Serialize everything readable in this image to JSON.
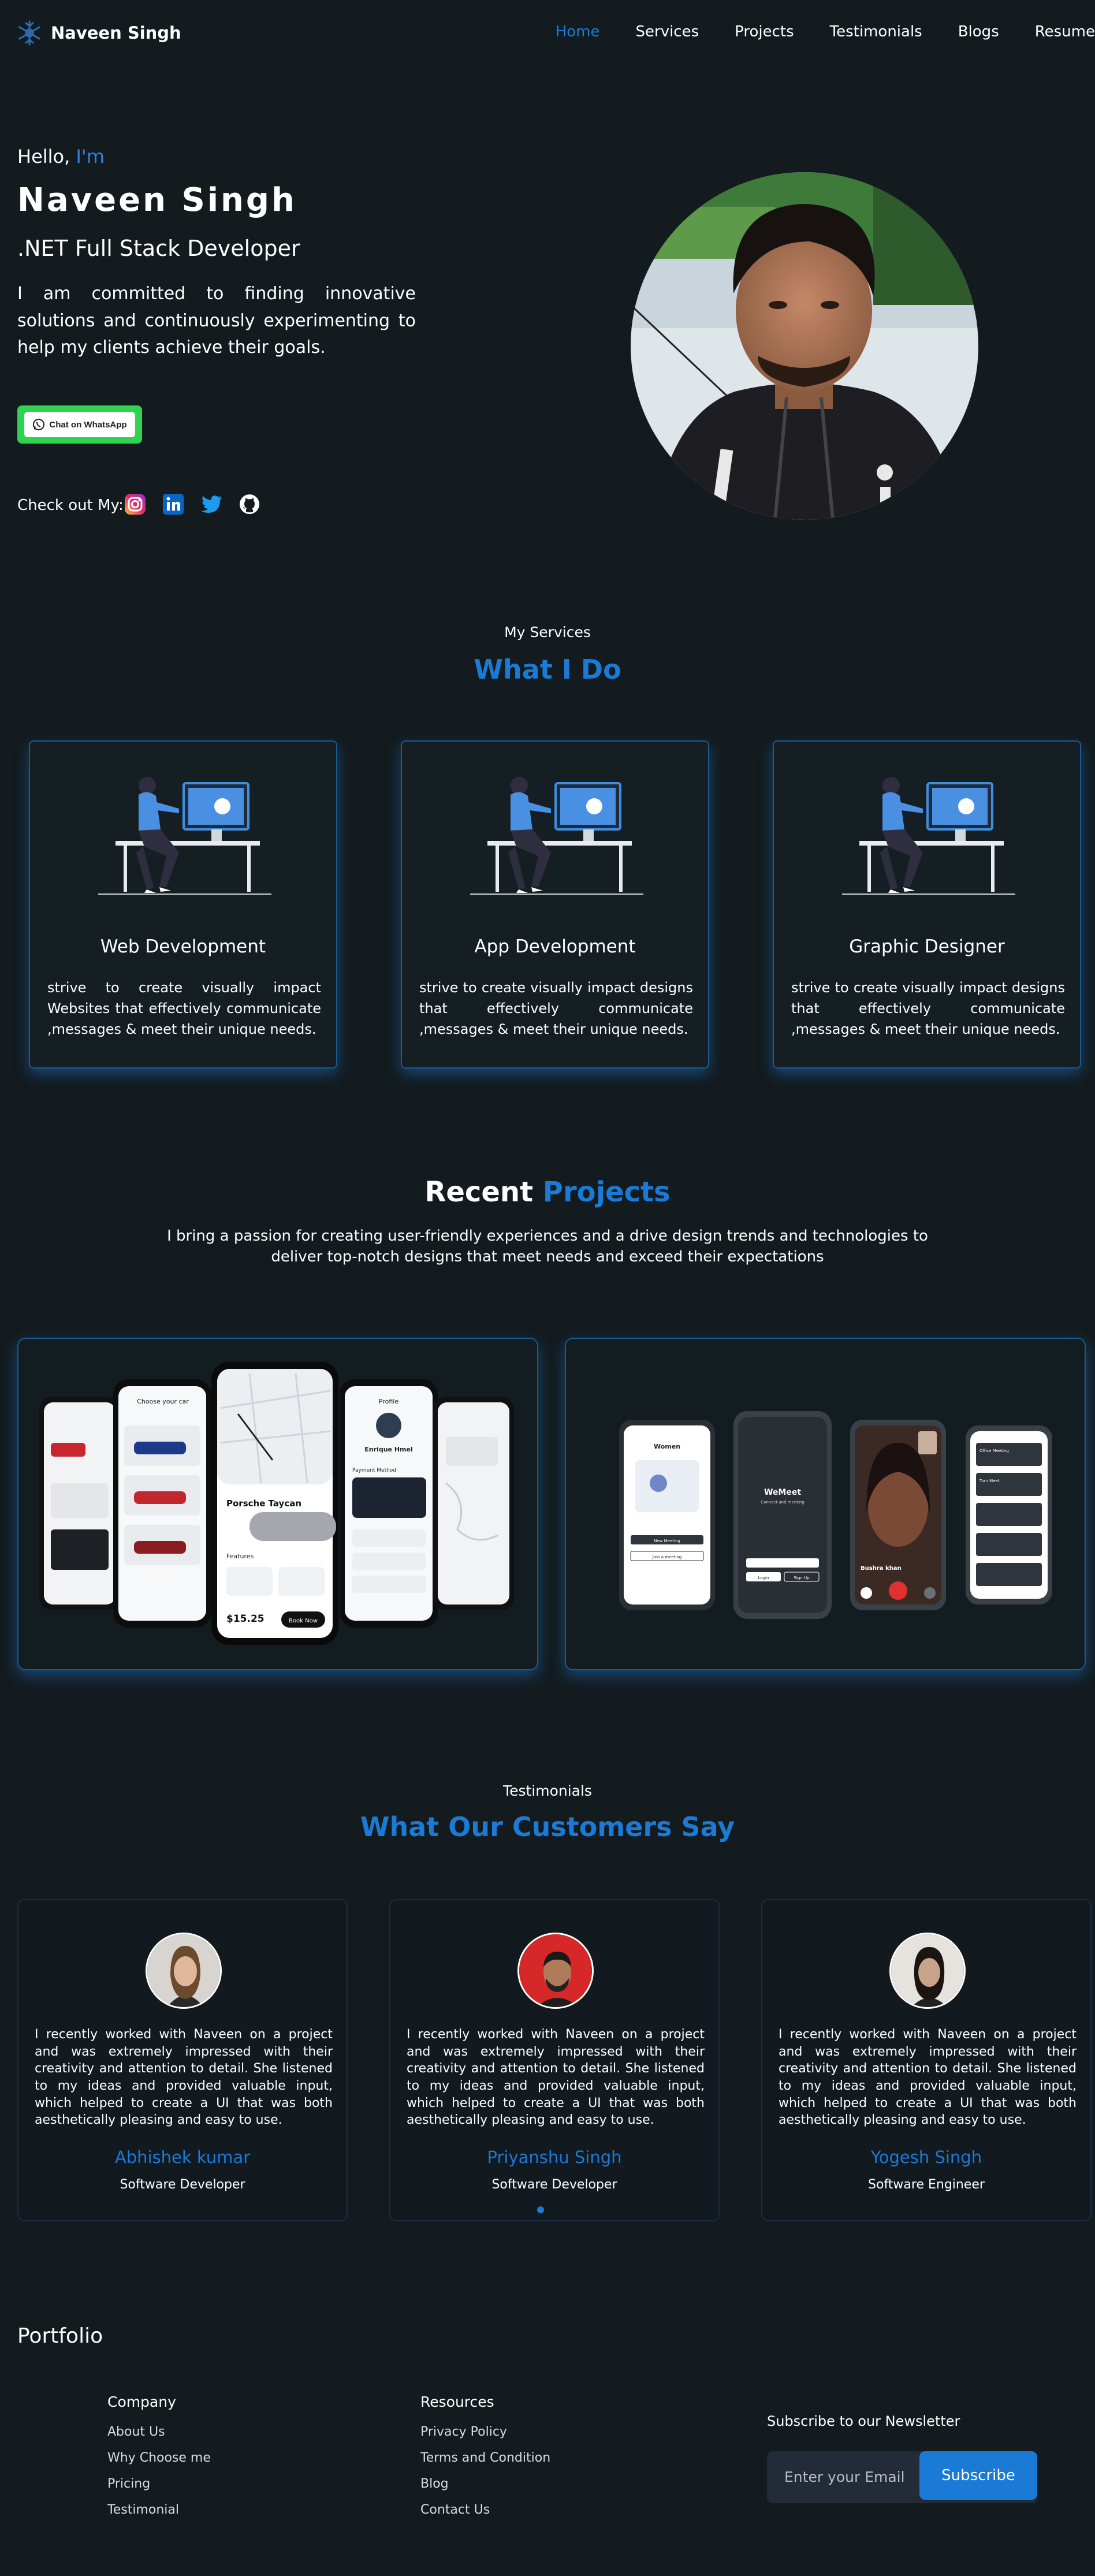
{
  "brand": {
    "name": "Naveen Singh",
    "logo_icon": "snowflake-icon"
  },
  "nav": {
    "items": [
      {
        "label": "Home",
        "active": true
      },
      {
        "label": "Services"
      },
      {
        "label": "Projects"
      },
      {
        "label": "Testimonials"
      },
      {
        "label": "Blogs"
      },
      {
        "label": "Resume"
      }
    ]
  },
  "hero": {
    "hello": "Hello,",
    "hello_highlight": "I'm",
    "name": "Naveen Singh",
    "role": ".NET Full Stack Developer",
    "description": "I am committed to finding innovative solutions and continuously experimenting to help my clients achieve their goals.",
    "whatsapp_label": "Chat on WhatsApp",
    "check_out": "Check out My:",
    "socials": [
      "instagram-icon",
      "linkedin-icon",
      "twitter-icon",
      "github-icon"
    ]
  },
  "services": {
    "small_title": "My Services",
    "title": "What I Do",
    "items": [
      {
        "title": "Web Development",
        "desc": "strive to create visually impact Websites that effectively communicate ,messages & meet their unique needs."
      },
      {
        "title": "App Development",
        "desc": "strive to create visually impact designs that effectively communicate ,messages & meet their unique needs."
      },
      {
        "title": "Graphic Designer",
        "desc": "strive to create visually impact designs that effectively communicate ,messages & meet their unique needs."
      }
    ]
  },
  "projects": {
    "title_white": "Recent",
    "title_blue": "Projects",
    "description": "I bring a passion for creating user-friendly experiences and a drive design trends and technologies to deliver top-notch designs that meet needs and exceed their expectations",
    "car_app": {
      "profile_title": "Profile",
      "profile_name": "Enrique Hmel",
      "car_title": "Porsche Taycan",
      "price": "$15.25",
      "book": "Book Now",
      "features": "Features",
      "payment": "Payment Method",
      "choose": "Choose your car"
    },
    "meet_app": {
      "welcome": "Women",
      "brand": "WeMeet",
      "tagline": "Connect and meeting",
      "new_meeting": "New Meeting",
      "join": "Join a meeting",
      "login": "Login",
      "signup": "Sign Up",
      "caller": "Bushra khan",
      "office": "Office Meeting",
      "turn": "Turn Meet"
    }
  },
  "testimonials": {
    "small_title": "Testimonials",
    "title": "What Our Customers Say",
    "items": [
      {
        "text": "I recently worked with Naveen on a project and was extremely impressed with their creativity and attention to detail. She listened to my ideas and provided valuable input, which helped to create a UI that was both aesthetically pleasing and easy to use.",
        "name": "Abhishek kumar",
        "role": "Software Developer"
      },
      {
        "text": "I recently worked with Naveen on a project and was extremely impressed with their creativity and attention to detail. She listened to my ideas and provided valuable input, which helped to create a UI that was both aesthetically pleasing and easy to use.",
        "name": "Priyanshu Singh",
        "role": "Software Developer"
      },
      {
        "text": "I recently worked with Naveen on a project and was extremely impressed with their creativity and attention to detail. She listened to my ideas and provided valuable input, which helped to create a UI that was both aesthetically pleasing and easy to use.",
        "name": "Yogesh Singh",
        "role": "Software Engineer"
      }
    ]
  },
  "footer": {
    "portfolio": "Portfolio",
    "company": {
      "title": "Company",
      "links": [
        "About Us",
        "Why Choose me",
        "Pricing",
        "Testimonial"
      ]
    },
    "resources": {
      "title": "Resources",
      "links": [
        "Privacy Policy",
        "Terms and Condition",
        "Blog",
        "Contact Us"
      ]
    },
    "newsletter": {
      "title": "Subscribe to our Newsletter",
      "placeholder": "Enter your Email",
      "button": "Subscribe"
    }
  },
  "colors": {
    "accent": "#1a7ad6",
    "background": "#131b1f",
    "whatsapp": "#2fd34f"
  }
}
